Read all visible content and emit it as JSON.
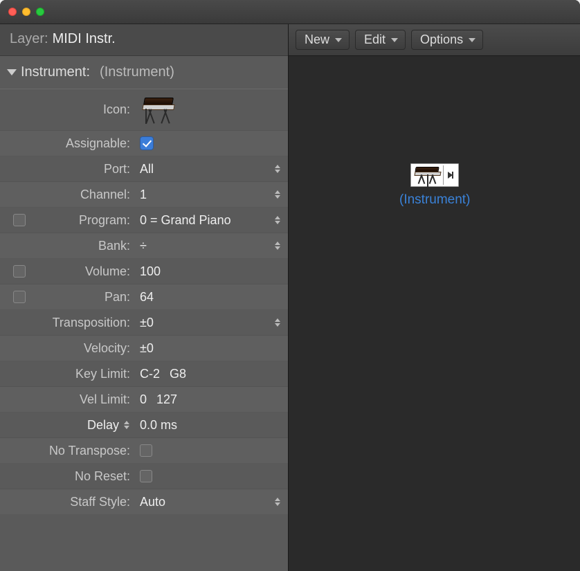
{
  "layer": {
    "label": "Layer:",
    "value": "MIDI Instr."
  },
  "section": {
    "label": "Instrument:",
    "value": "(Instrument)"
  },
  "params": {
    "icon_label": "Icon:",
    "assignable_label": "Assignable:",
    "assignable_checked": true,
    "port_label": "Port:",
    "port_value": "All",
    "channel_label": "Channel:",
    "channel_value": "1",
    "program_label": "Program:",
    "program_value": "0 = Grand Piano",
    "bank_label": "Bank:",
    "bank_value": "÷",
    "volume_label": "Volume:",
    "volume_value": "100",
    "pan_label": "Pan:",
    "pan_value": "64",
    "transposition_label": "Transposition:",
    "transposition_value": "±0",
    "velocity_label": "Velocity:",
    "velocity_value": "±0",
    "keylimit_label": "Key Limit:",
    "keylimit_low": "C-2",
    "keylimit_high": "G8",
    "vellimit_label": "Vel Limit:",
    "vellimit_low": "0",
    "vellimit_high": "127",
    "delay_label": "Delay",
    "delay_value": "0.0 ms",
    "notranspose_label": "No Transpose:",
    "noreset_label": "No Reset:",
    "staffstyle_label": "Staff Style:",
    "staffstyle_value": "Auto"
  },
  "toolbar": {
    "new": "New",
    "edit": "Edit",
    "options": "Options"
  },
  "canvas_object": {
    "label": "(Instrument)"
  }
}
